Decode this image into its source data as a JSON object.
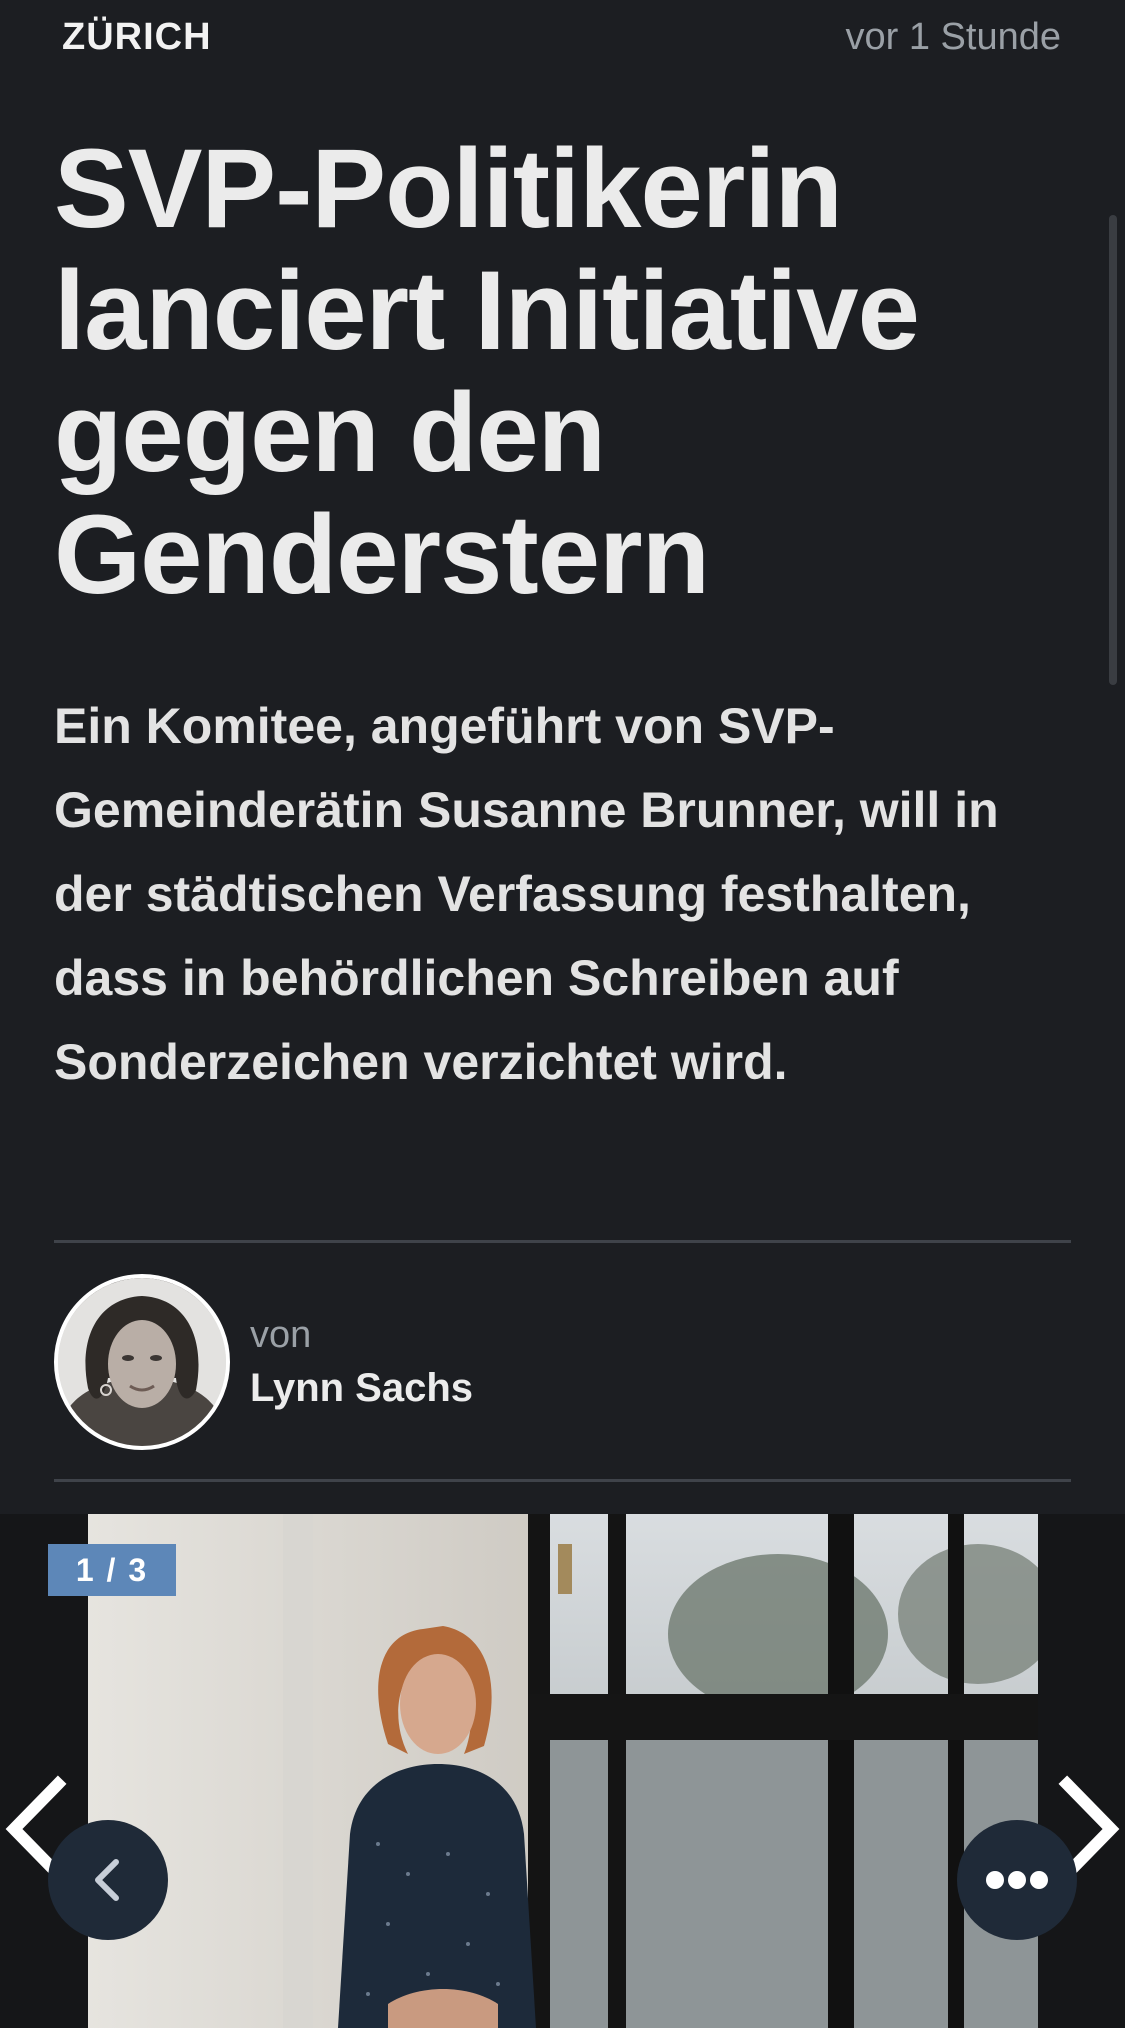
{
  "header": {
    "section": "ZÜRICH",
    "timestamp": "vor 1 Stunde"
  },
  "article": {
    "headline": "SVP-Politikerin lanciert Initiative gegen den Genderstern",
    "lead": "Ein Komitee, angeführt von SVP-Gemeinderätin Susanne Brunner, will in der städtischen Verfassung festhalten, dass in behördlichen Schreiben auf Sonderzeichen verzichtet wird."
  },
  "author": {
    "prefix": "von",
    "name": "Lynn Sachs"
  },
  "gallery": {
    "counter": "1 / 3",
    "current_index": 1,
    "total": 3
  },
  "icons": {
    "prev": "chevron-left-icon",
    "next": "chevron-right-icon",
    "back": "back-arrow-icon",
    "more": "more-dots-icon"
  },
  "colors": {
    "background": "#1c1e22",
    "badge": "#5d87b8",
    "round_button": "#1f2a38"
  }
}
